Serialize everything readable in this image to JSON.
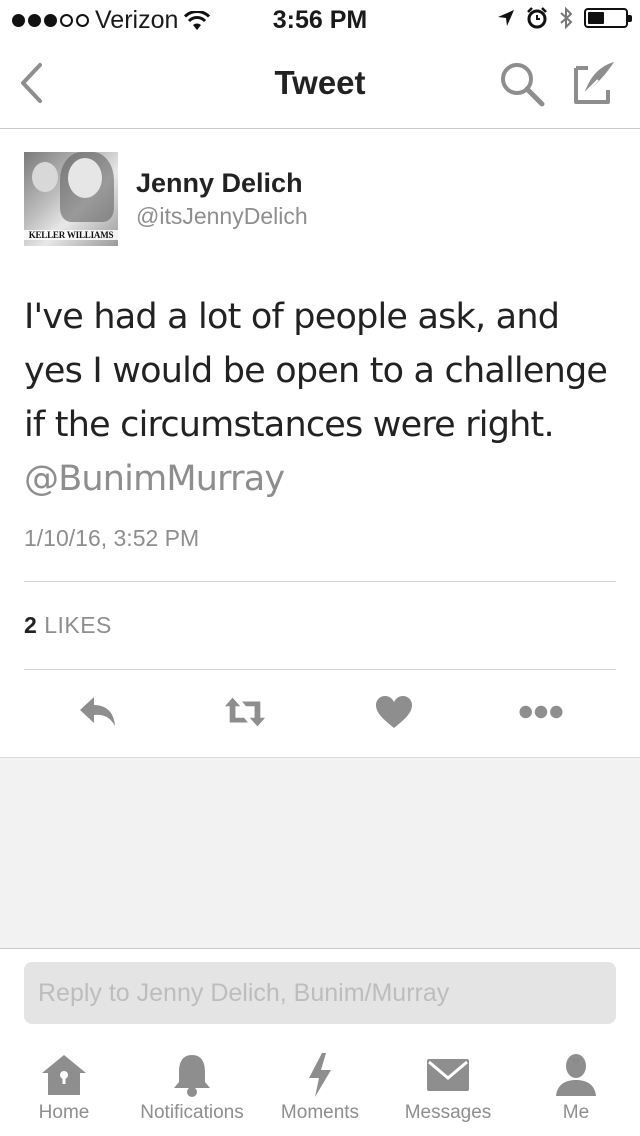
{
  "status_bar": {
    "carrier": "Verizon",
    "time": "3:56 PM"
  },
  "nav": {
    "title": "Tweet"
  },
  "tweet": {
    "author_name": "Jenny Delich",
    "author_handle": "@itsJennyDelich",
    "avatar_brand_text": "KELLER WILLIAMS",
    "text": "I've had a lot of people ask, and yes I would be open to a challenge if the circumstances were right.",
    "mention": "@BunimMurray",
    "timestamp": "1/10/16, 3:52 PM",
    "likes_count": "2",
    "likes_label": "LIKES"
  },
  "actions": [
    "reply-icon",
    "retweet-icon",
    "heart-icon",
    "more-icon"
  ],
  "reply_box": {
    "placeholder": "Reply to Jenny Delich, Bunim/Murray"
  },
  "tab_bar": {
    "home": "Home",
    "notifications": "Notifications",
    "moments": "Moments",
    "messages": "Messages",
    "me": "Me"
  },
  "colors": {
    "text": "#222222",
    "secondary_text": "#8e8e8e",
    "icons": "#8e8e8e",
    "divider": "#d4d4d4",
    "background_gray": "#f2f2f2"
  }
}
